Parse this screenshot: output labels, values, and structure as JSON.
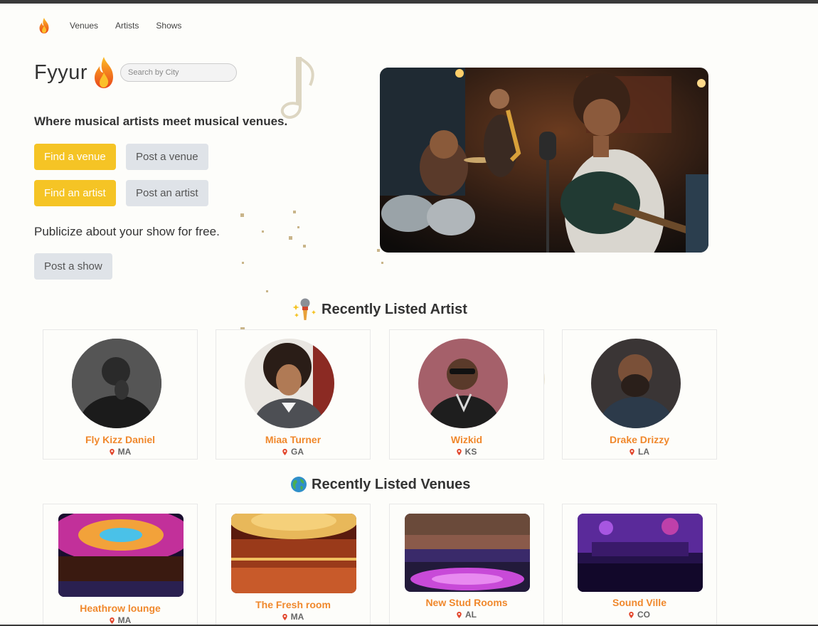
{
  "nav": {
    "items": [
      {
        "label": "Venues"
      },
      {
        "label": "Artists"
      },
      {
        "label": "Shows"
      }
    ]
  },
  "hero": {
    "title": "Fyyur",
    "search_placeholder": "Search by City",
    "tagline": "Where musical artists meet musical venues.",
    "buttons": {
      "find_venue": "Find a venue",
      "post_venue": "Post a venue",
      "find_artist": "Find an artist",
      "post_artist": "Post an artist",
      "post_show": "Post a show"
    },
    "publicize": "Publicize about your show for free."
  },
  "artists_section": {
    "title": "Recently Listed Artist",
    "items": [
      {
        "name": "Fly Kizz Daniel",
        "state": "MA"
      },
      {
        "name": "Miaa Turner",
        "state": "GA"
      },
      {
        "name": "Wizkid",
        "state": "KS"
      },
      {
        "name": "Drake Drizzy",
        "state": "LA"
      }
    ]
  },
  "venues_section": {
    "title": "Recently Listed Venues",
    "items": [
      {
        "name": "Heathrow lounge",
        "state": "MA"
      },
      {
        "name": "The Fresh room",
        "state": "MA"
      },
      {
        "name": "New Stud Rooms",
        "state": "AL"
      },
      {
        "name": "Sound Ville",
        "state": "CO"
      }
    ]
  },
  "colors": {
    "accent_yellow": "#f5c425",
    "accent_orange": "#f0882c",
    "button_gray": "#dfe3e8"
  },
  "icons": [
    "flame-icon",
    "microphone-icon",
    "globe-icon",
    "location-pin-icon",
    "music-note-icon"
  ]
}
